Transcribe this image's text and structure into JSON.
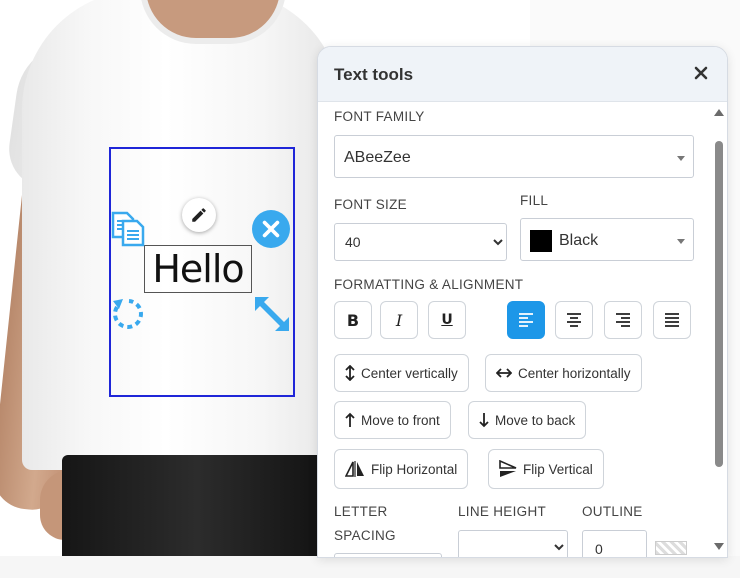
{
  "canvas": {
    "design_text": "Hello"
  },
  "panel": {
    "title": "Text tools",
    "font_family": {
      "label": "FONT FAMILY",
      "value": "ABeeZee"
    },
    "font_size": {
      "label": "FONT SIZE",
      "value": "40",
      "options": [
        "40"
      ]
    },
    "fill": {
      "label": "FILL",
      "value": "Black",
      "color": "#000000"
    },
    "formatting": {
      "label": "FORMATTING & ALIGNMENT",
      "active_alignment": "left"
    },
    "actions": {
      "center_vertically": "Center vertically",
      "center_horizontally": "Center horizontally",
      "move_to_front": "Move to front",
      "move_to_back": "Move to back",
      "flip_horizontal": "Flip Horizontal",
      "flip_vertical": "Flip Vertical"
    },
    "letter_spacing": {
      "label_line1": "LETTER",
      "label_line2": "SPACING"
    },
    "line_height": {
      "label": "LINE HEIGHT"
    },
    "outline": {
      "label": "OUTLINE",
      "value": "0"
    }
  },
  "colors": {
    "accent": "#1d97e8",
    "design_border": "#1f26d8",
    "control_blue": "#39a9ee"
  }
}
